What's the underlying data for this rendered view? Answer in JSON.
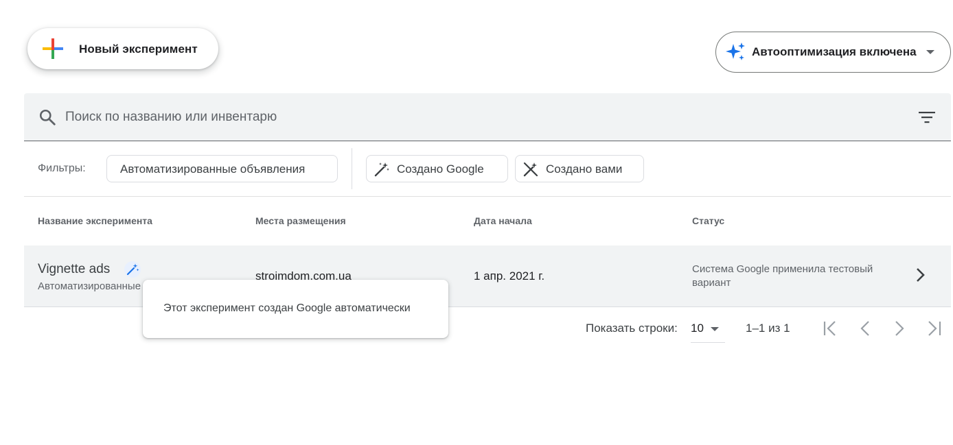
{
  "toolbar": {
    "new_experiment_label": "Новый эксперимент",
    "autoopt_label": "Автооптимизация включена"
  },
  "search": {
    "placeholder": "Поиск по названию или инвентарю"
  },
  "filters": {
    "label": "Фильтры:",
    "chips": [
      {
        "label": "Автоматизированные объявления"
      },
      {
        "label": "Создано Google"
      },
      {
        "label": "Создано вами"
      }
    ]
  },
  "table": {
    "headers": [
      "Название эксперимента",
      "Места размещения",
      "Дата начала",
      "Статус"
    ],
    "rows": [
      {
        "name": "Vignette ads",
        "type": "Автоматизированные объявления",
        "placement": "stroimdom.com.ua",
        "start_date": "1 апр. 2021 г.",
        "status": "Система Google применила тестовый вариант"
      }
    ]
  },
  "tooltip": {
    "text": "Этот эксперимент создан Google автоматически"
  },
  "pagination": {
    "rows_label": "Показать строки:",
    "rows_value": "10",
    "range": "1–1 из 1"
  },
  "colors": {
    "accent_blue": "#1a73e8",
    "google_red": "#ea4335",
    "google_yellow": "#fbbc04",
    "google_green": "#34a853",
    "google_blue": "#4285f4"
  },
  "icons": [
    "plus-icon",
    "sparkle-icon",
    "search-icon",
    "filter-icon",
    "magic-wand-icon",
    "wand-off-icon",
    "chevron-right-icon",
    "first-page-icon",
    "prev-page-icon",
    "next-page-icon",
    "last-page-icon"
  ]
}
